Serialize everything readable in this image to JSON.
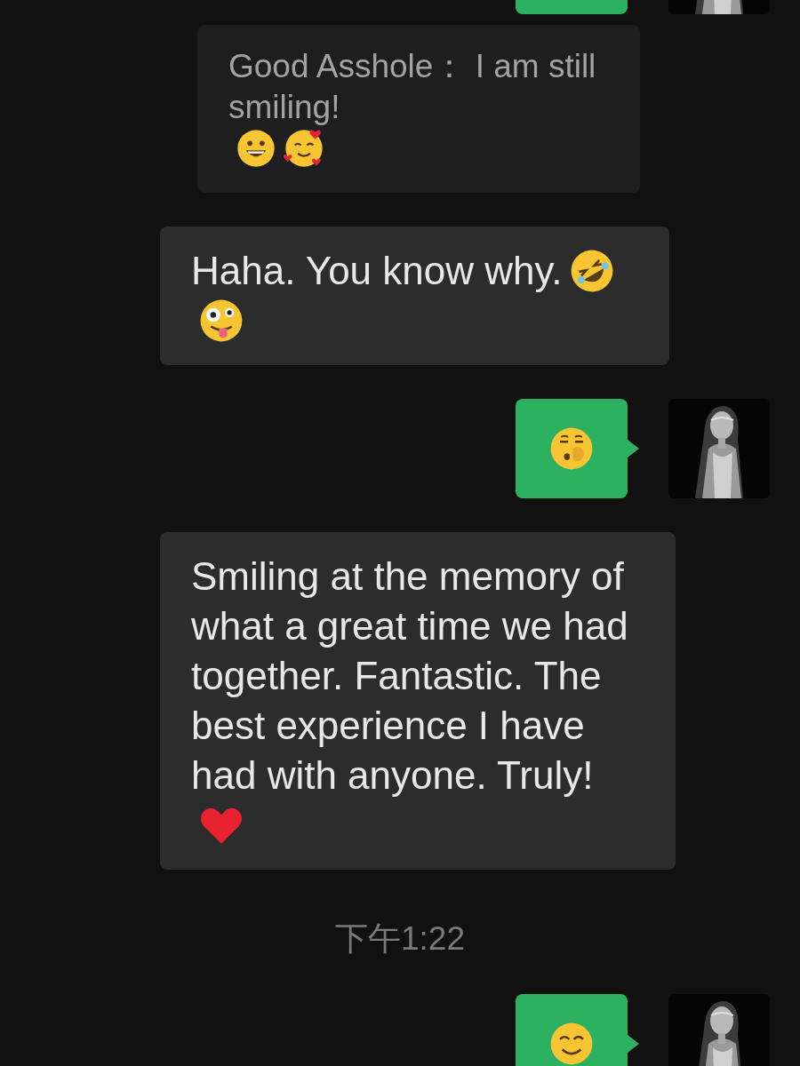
{
  "messages": [
    {
      "kind": "outgoing"
    },
    {
      "kind": "quote",
      "text": "Good Asshole： I am still smiling!",
      "emojis": [
        {
          "kind": "grin"
        },
        {
          "kind": "hearts-smile"
        }
      ]
    },
    {
      "kind": "incoming",
      "text": "Haha. You know why.",
      "emojis": [
        {
          "kind": "rofl"
        },
        {
          "kind": "zany"
        }
      ]
    },
    {
      "kind": "outgoing",
      "emojis": [
        {
          "kind": "hand-over-mouth"
        }
      ]
    },
    {
      "kind": "incoming",
      "text": "Smiling at the memory of what a great time we had together. Fantastic. The best experience I have had with anyone. Truly!",
      "emojis": [
        {
          "kind": "heart"
        }
      ]
    },
    {
      "kind": "time",
      "text": "下午1:22"
    },
    {
      "kind": "outgoing",
      "emojis": [
        {
          "kind": "smile"
        }
      ]
    }
  ]
}
